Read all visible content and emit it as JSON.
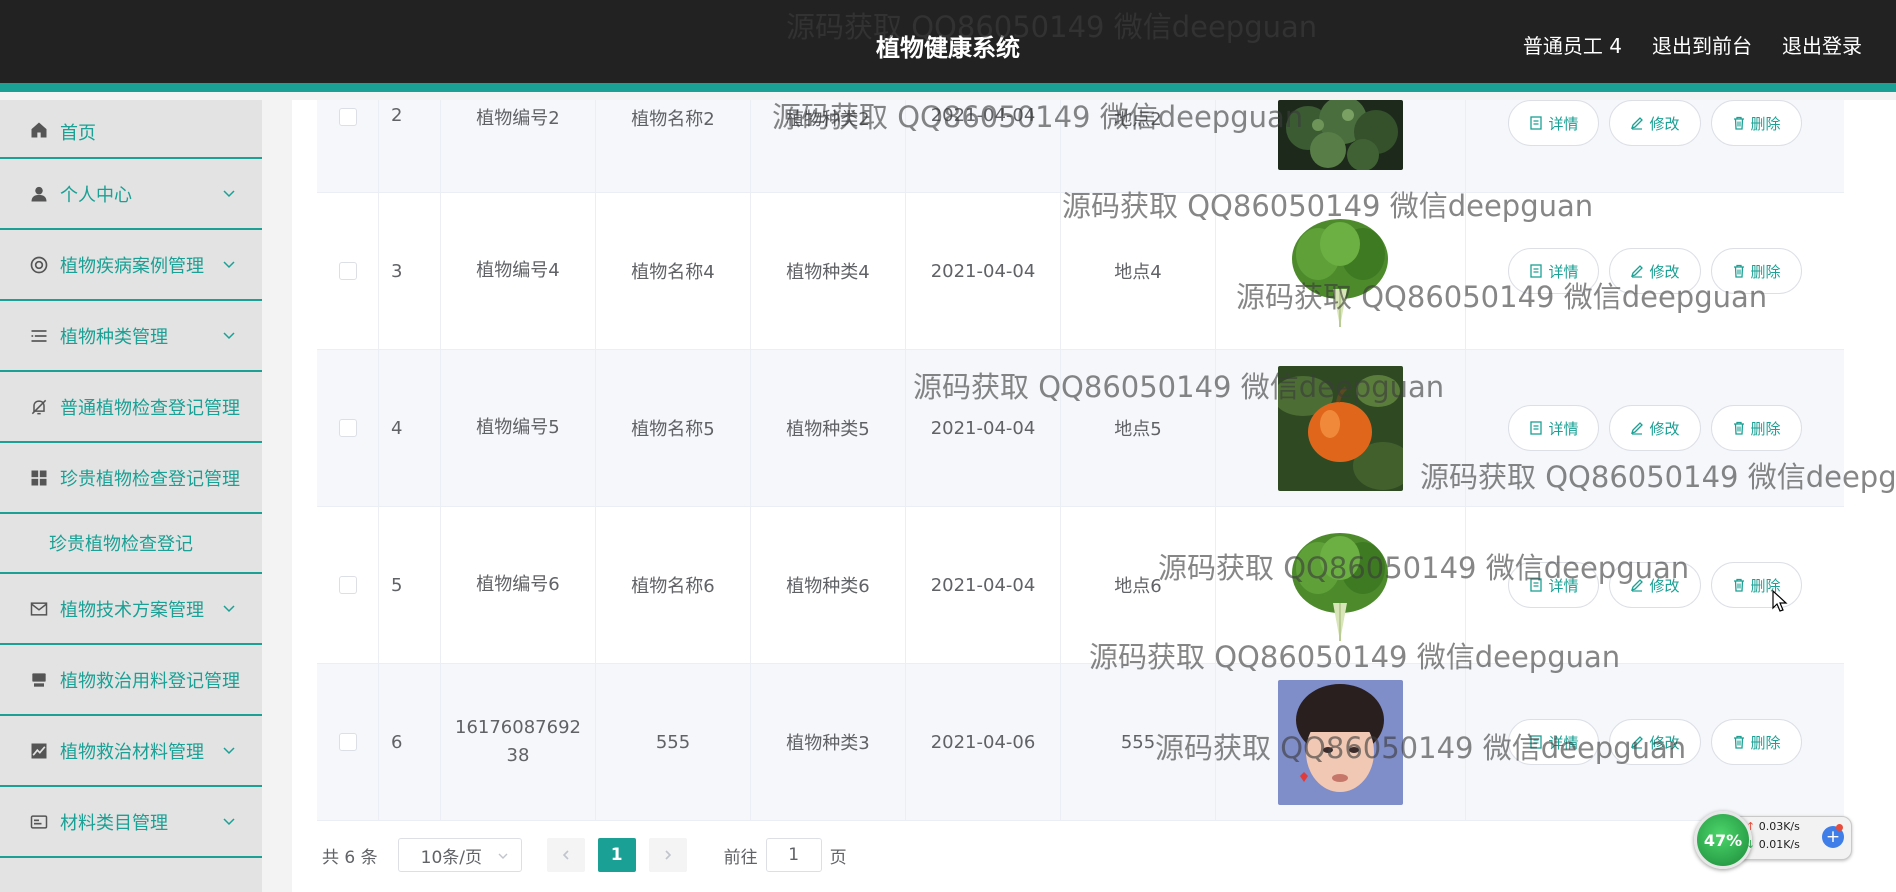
{
  "header": {
    "title": "植物健康系统",
    "user_label": "普通员工 4",
    "back_label": "退出到前台",
    "logout_label": "退出登录"
  },
  "sidebar": {
    "items": [
      {
        "label": "首页",
        "icon": "home-icon"
      },
      {
        "label": "个人中心",
        "icon": "user-icon"
      },
      {
        "label": "植物疾病案例管理",
        "icon": "help-circle-icon"
      },
      {
        "label": "植物种类管理",
        "icon": "list-icon"
      },
      {
        "label": "普通植物检查登记管理",
        "icon": "bell-off-icon"
      },
      {
        "label": "珍贵植物检查登记管理",
        "icon": "grid-icon"
      },
      {
        "label": "植物技术方案管理",
        "icon": "mail-icon"
      },
      {
        "label": "植物救治用料登记管理",
        "icon": "box-icon"
      },
      {
        "label": "植物救治材料管理",
        "icon": "chart-icon"
      },
      {
        "label": "材料类目管理",
        "icon": "card-icon"
      }
    ],
    "submenu": {
      "label": "珍贵植物检查登记"
    }
  },
  "table": {
    "rows": [
      {
        "index": "2",
        "code": "植物编号2",
        "name": "植物名称2",
        "kind": "植物种类2",
        "date": "2021-04-04",
        "place": "地点2",
        "image": "broccoli"
      },
      {
        "index": "3",
        "code": "植物编号4",
        "name": "植物名称4",
        "kind": "植物种类4",
        "date": "2021-04-04",
        "place": "地点4",
        "image": "lettuce"
      },
      {
        "index": "4",
        "code": "植物编号5",
        "name": "植物名称5",
        "kind": "植物种类5",
        "date": "2021-04-04",
        "place": "地点5",
        "image": "pumpkin"
      },
      {
        "index": "5",
        "code": "植物编号6",
        "name": "植物名称6",
        "kind": "植物种类6",
        "date": "2021-04-04",
        "place": "地点6",
        "image": "lettuce"
      },
      {
        "index": "6",
        "code": "1617608769238",
        "name": "555",
        "kind": "植物种类3",
        "date": "2021-04-06",
        "place": "555",
        "image": "person"
      }
    ],
    "ops": {
      "detail": "详情",
      "edit": "修改",
      "delete": "删除"
    }
  },
  "pagination": {
    "total": "共 6 条",
    "page_size": "10条/页",
    "current_page": "1",
    "goto_prefix": "前往",
    "goto_value": "1",
    "goto_suffix": "页"
  },
  "watermark": {
    "text": "源码获取 QQ86050149 微信deepguan"
  },
  "speed_widget": {
    "percent": "47%",
    "upload": "0.03K/s",
    "download": "0.01K/s"
  },
  "colors": {
    "accent": "#1aa094",
    "header_bg": "#222222",
    "sidebar_bg": "#e3e3e3"
  }
}
